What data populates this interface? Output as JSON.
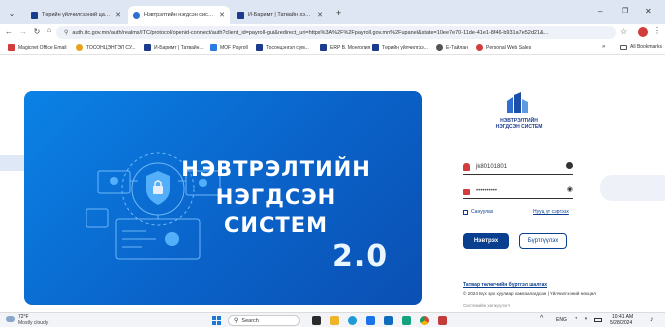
{
  "browser": {
    "tabs": [
      {
        "title": "Төрийн үйлчилгээний цахим...",
        "active": false,
        "favicon_color": "#1b3b8f"
      },
      {
        "title": "Нэвтрэлтийн нэгдсэн систем",
        "active": true,
        "favicon_color": "#2f6fd1"
      },
      {
        "title": "И-Баримт | Татвайн хэлтэс",
        "active": false,
        "favicon_color": "#1b3b8f"
      }
    ],
    "new_tab_symbol": "+",
    "window_controls": {
      "minimize": "–",
      "maximize": "❐",
      "close": "✕"
    },
    "url": "auth.itc.gov.mn/auth/realms/ITC/protocol/openid-connect/auth?client_id=payroll-gui&redirect_uri=https%3A%2F%2Fpayroll.gov.mn%2Fupanel&state=10ee7e70-11de-41e1-8f46-b931a7e52d21&...",
    "bookmarks": [
      {
        "label": "Magicnet Office Email",
        "color": "#d23c3c"
      },
      {
        "label": "ТОСОНЦЭНГЭЛ СУ...",
        "color": "#e6a21c"
      },
      {
        "label": "И-Баримт | Татвайн...",
        "color": "#1b3b8f"
      },
      {
        "label": "MOF Payroll",
        "color": "#2c7be5"
      },
      {
        "label": "Тосонцэнгэл сум...",
        "color": "#1b3b8f"
      },
      {
        "label": "ERP B. Монголия",
        "color": "#1b3b8f"
      },
      {
        "label": "Төрийн үйлчилгээ...",
        "color": "#1b3b8f"
      },
      {
        "label": "Е-Тайлан",
        "color": "#555555"
      },
      {
        "label": "Personal Web Sales",
        "color": "#d23c3c"
      }
    ],
    "all_bookmarks": "All Bookmarks"
  },
  "hero": {
    "title_line1": "НЭВТРЭЛТИЙН",
    "title_line2": "НЭГДСЭН",
    "title_line3": "СИСТЕМ",
    "version": "2.0"
  },
  "login": {
    "logo_line1": "НЭВТРЭЛТИЙН",
    "logo_line2": "НЭГДСЭН СИСТЕМ",
    "username_value": "jk80101801",
    "password_value": "••••••••••",
    "remember_label": "Сануулах",
    "forgot_label": "Нууц үг сэргээх",
    "login_button": "Нэвтрэх",
    "register_button": "Бүртгүүлэх",
    "guide_link": "Татвар төлөгчийн бүртгэл шалгах",
    "footer_text": "© 2024 Бүх эрх хуулиар хамгаалагдсан | Үйлчилгээний нөхцөл",
    "footer_small": "Системийн хөгжүүлэгч"
  },
  "taskbar": {
    "weather_temp": "72°F",
    "weather_desc": "Mostly cloudy",
    "search_placeholder": "Search",
    "lang": "ENG",
    "time": "10:41 AM",
    "date": "5/28/2024"
  },
  "colors": {
    "accent": "#0a63c9",
    "button_primary": "#0a3f8f",
    "button_secondary_border": "#0a3f8f"
  }
}
